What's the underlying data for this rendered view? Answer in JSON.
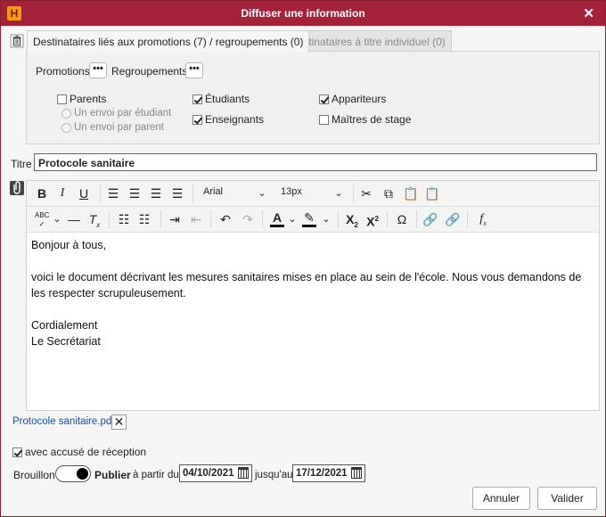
{
  "window": {
    "title": "Diffuser une information",
    "logo": "H"
  },
  "tabs": [
    {
      "label": "Destinataires liés aux promotions (7) / regroupements (0)"
    },
    {
      "label": "Destinataires à titre individuel (0)"
    }
  ],
  "filters": {
    "promotions": "Promotions",
    "regroupements": "Regroupements",
    "dots": "•••"
  },
  "recipients": {
    "parents": "Parents",
    "per_student": "Un envoi par étudiant",
    "per_parent": "Un envoi par parent",
    "etudiants": "Étudiants",
    "enseignants": "Enseignants",
    "appariteurs": "Appariteurs",
    "maitres": "Maîtres de stage"
  },
  "titre": {
    "label": "Titre",
    "value": "Protocole sanitaire"
  },
  "editor": {
    "font": "Arial",
    "size": "13px",
    "lines": {
      "greeting": "Bonjour à tous,",
      "body": "voici le document décrivant les mesures sanitaires mises en place au sein de l'école. Nous vous demandons de les respecter scrupuleusement.",
      "closing": "Cordialement",
      "signature": "Le Secrétariat"
    }
  },
  "attachment": {
    "name": "Protocole sanitaire.pdf"
  },
  "ack": {
    "label": "avec accusé de réception",
    "checked": true
  },
  "publication": {
    "draft_label": "Brouillon",
    "publish_label": "Publier",
    "from_label": "à partir du",
    "from_date": "04/10/2021",
    "until_label": "jusqu'au",
    "until_date": "17/12/2021"
  },
  "buttons": {
    "cancel": "Annuler",
    "ok": "Valider"
  }
}
